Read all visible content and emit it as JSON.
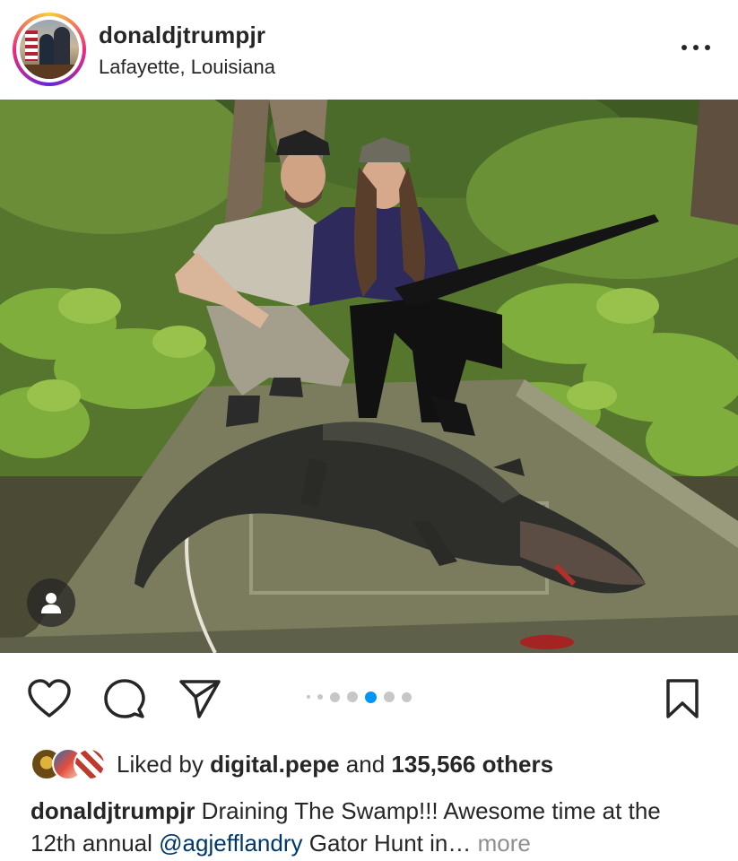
{
  "post": {
    "username": "donaldjtrumpjr",
    "location": "Lafayette, Louisiana"
  },
  "icons": {
    "more": "more-horizontal-icon",
    "like": "heart-icon",
    "comment": "comment-bubble-icon",
    "share": "paper-plane-icon",
    "save": "bookmark-icon",
    "tag": "user-tag-icon"
  },
  "carousel": {
    "count": 7,
    "active_index": 4
  },
  "likes": {
    "prefix": "Liked by",
    "liked_by_user": "digital.pepe",
    "conjunction": "and",
    "others": "135,566 others"
  },
  "caption": {
    "username": "donaldjtrumpjr",
    "text_start": "Draining The Swamp!!! Awesome time at the 12th annual",
    "mention": "@agjefflandry",
    "text_end": "Gator Hunt in…",
    "more": "more"
  },
  "colors": {
    "text": "#262626",
    "accent": "#0095f6",
    "mention": "#00376b",
    "muted": "#8e8e8e"
  }
}
